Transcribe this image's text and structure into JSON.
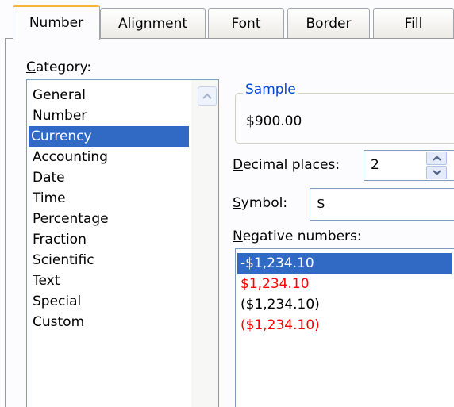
{
  "tabs": [
    {
      "label": "Number",
      "active": true
    },
    {
      "label": "Alignment",
      "active": false
    },
    {
      "label": "Font",
      "active": false
    },
    {
      "label": "Border",
      "active": false
    },
    {
      "label": "Fill",
      "active": false
    }
  ],
  "category": {
    "label_first": "C",
    "label_rest": "ategory:",
    "items": [
      "General",
      "Number",
      "Currency",
      "Accounting",
      "Date",
      "Time",
      "Percentage",
      "Fraction",
      "Scientific",
      "Text",
      "Special",
      "Custom"
    ],
    "selected": "Currency"
  },
  "sample": {
    "legend": "Sample",
    "value": "$900.00"
  },
  "decimal_places": {
    "label_first": "D",
    "label_rest": "ecimal places:",
    "value": "2"
  },
  "symbol": {
    "label_first": "S",
    "label_rest": "ymbol:",
    "value": "$"
  },
  "negative_numbers": {
    "label_first": "N",
    "label_rest": "egative numbers:",
    "items": [
      {
        "text": "-$1,234.10",
        "color": "black",
        "selected": true
      },
      {
        "text": "$1,234.10",
        "color": "red",
        "selected": false
      },
      {
        "text": "($1,234.10)",
        "color": "black",
        "selected": false
      },
      {
        "text": "($1,234.10)",
        "color": "red",
        "selected": false
      }
    ]
  },
  "colors": {
    "selection": "#316ac5",
    "negative_red": "#ff0000",
    "group_title": "#0046d5",
    "active_tab_accent": "#f3b63b"
  },
  "icons": {
    "scroll_up": "scroll-up-arrow-icon",
    "spin_up": "spin-up-icon",
    "spin_down": "spin-down-icon"
  }
}
